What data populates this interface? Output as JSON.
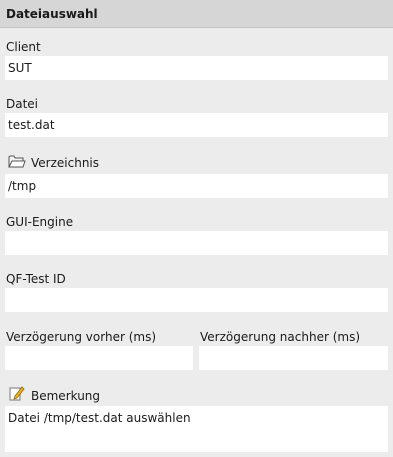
{
  "header": {
    "title": "Dateiauswahl"
  },
  "client": {
    "label": "Client",
    "value": "SUT"
  },
  "file": {
    "label": "Datei",
    "value": "test.dat"
  },
  "directory": {
    "label": "Verzeichnis",
    "value": "/tmp",
    "icon": "folder-icon"
  },
  "gui_engine": {
    "label": "GUI-Engine",
    "value": ""
  },
  "qftest_id": {
    "label": "QF-Test ID",
    "value": ""
  },
  "delay_before": {
    "label": "Verzögerung vorher (ms)",
    "value": ""
  },
  "delay_after": {
    "label": "Verzögerung nachher (ms)",
    "value": ""
  },
  "comment": {
    "label": "Bemerkung",
    "value": "Datei /tmp/test.dat auswählen",
    "icon": "pencil-note-icon"
  }
}
